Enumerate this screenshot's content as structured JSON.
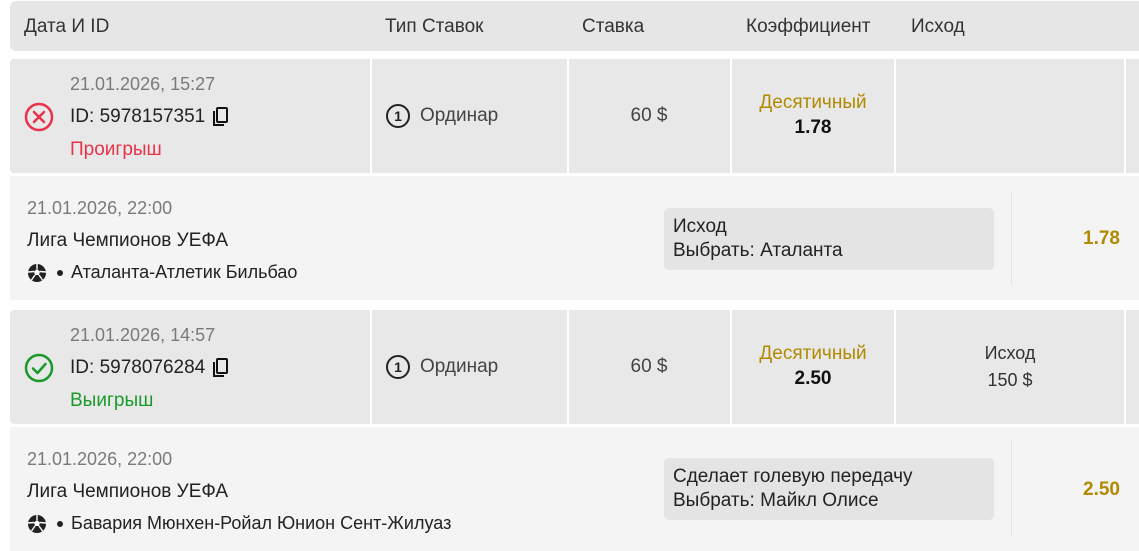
{
  "header": {
    "date_id": "Дата И ID",
    "bet_type": "Тип Ставок",
    "stake": "Ставка",
    "odds": "Коэффициент",
    "outcome": "Исход"
  },
  "bets": [
    {
      "datetime": "21.01.2026, 15:27",
      "id_label": "ID:",
      "id": "5978157351",
      "status": "Проигрыш",
      "status_icon": "x-circle-icon",
      "bet_type_number": "1",
      "bet_type": "Ординар",
      "stake": "60 $",
      "odds_format": "Десятичный",
      "odds": "1.78",
      "outcome_label": "",
      "outcome_value": "",
      "event": {
        "datetime": "21.01.2026, 22:00",
        "league": "Лига Чемпионов УЕФА",
        "sport_icon": "soccer-ball-icon",
        "match": "Аталанта-Атлетик Бильбао",
        "market": "Исход",
        "selection": "Выбрать: Аталанта",
        "odds": "1.78"
      }
    },
    {
      "datetime": "21.01.2026, 14:57",
      "id_label": "ID:",
      "id": "5978076284",
      "status": "Выигрыш",
      "status_icon": "check-circle-icon",
      "bet_type_number": "1",
      "bet_type": "Ординар",
      "stake": "60 $",
      "odds_format": "Десятичный",
      "odds": "2.50",
      "outcome_label": "Исход",
      "outcome_value": "150 $",
      "event": {
        "datetime": "21.01.2026, 22:00",
        "league": "Лига Чемпионов УЕФА",
        "sport_icon": "soccer-ball-icon",
        "match": "Бавария Мюнхен-Ройал Юнион Сент-Жилуаз",
        "market": "Сделает голевую передачу",
        "selection": "Выбрать: Майкл Олисе",
        "odds": "2.50"
      }
    }
  ],
  "colors": {
    "lost": "#e8334a",
    "won": "#1a9a2a",
    "odds_accent": "#b08a00"
  }
}
